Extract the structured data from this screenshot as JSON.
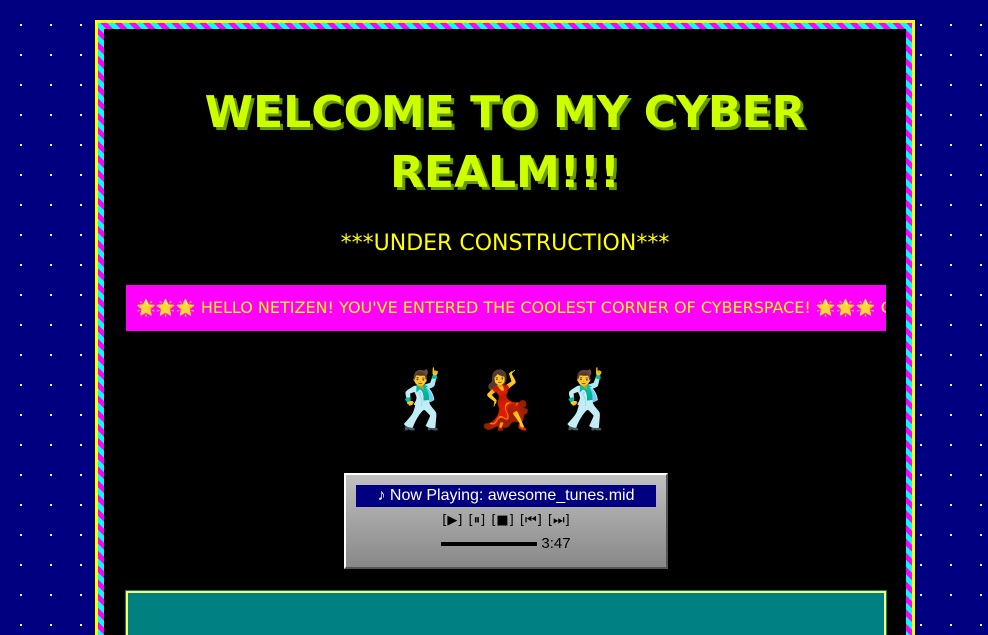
{
  "title": "WELCOME TO MY CYBER REALM!!!",
  "subtitle": "***UNDER CONSTRUCTION***",
  "marquee": {
    "text": "🌟🌟🌟 HELLO NETIZEN! YOU'VE ENTERED THE COOLEST CORNER OF CYBERSPACE! 🌟🌟🌟 C"
  },
  "dancers": [
    "🕺",
    "💃",
    "🕺"
  ],
  "player": {
    "now_playing": "♪ Now Playing: awesome_tunes.mid",
    "controls": {
      "play": "[▶]",
      "pause": "[⏸]",
      "stop": "[■]",
      "prev": "[⏮]",
      "next": "[⏭]"
    },
    "progress": 1.0,
    "time": "3:47"
  },
  "colors": {
    "background": "#000080",
    "title": "#ccff00",
    "subtitle": "#ffff00",
    "marquee_bg": "#ff00ff",
    "panel": "#008080"
  }
}
